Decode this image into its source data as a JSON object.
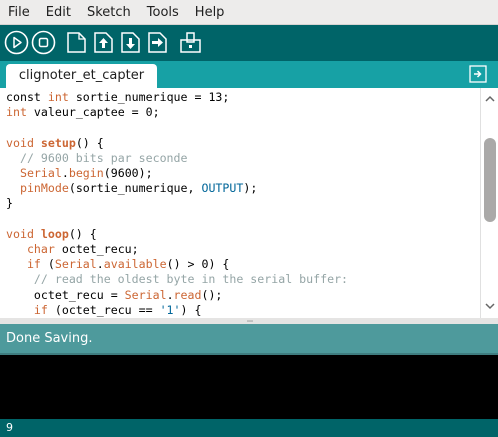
{
  "menu": {
    "items": [
      "File",
      "Edit",
      "Sketch",
      "Tools",
      "Help"
    ]
  },
  "toolbar": {
    "buttons": [
      {
        "name": "verify",
        "icon": "play-icon"
      },
      {
        "name": "stop",
        "icon": "stop-icon"
      },
      {
        "name": "new",
        "icon": "new-file-icon"
      },
      {
        "name": "open",
        "icon": "open-arrow-up-icon"
      },
      {
        "name": "save",
        "icon": "save-arrow-down-icon"
      },
      {
        "name": "upload",
        "icon": "upload-arrow-right-icon"
      },
      {
        "name": "serial-monitor",
        "icon": "serial-monitor-icon"
      }
    ]
  },
  "tabs": {
    "active": "clignoter_et_capter",
    "menu_icon": "tab-menu-arrow-icon"
  },
  "editor": {
    "lines": [
      [
        {
          "t": "const "
        },
        {
          "t": "int",
          "c": "kw"
        },
        {
          "t": " sortie_numerique = 13;"
        }
      ],
      [
        {
          "t": "int",
          "c": "kw"
        },
        {
          "t": " valeur_captee = 0;"
        }
      ],
      [],
      [
        {
          "t": "void",
          "c": "kw"
        },
        {
          "t": " "
        },
        {
          "t": "setup",
          "c": "fn"
        },
        {
          "t": "() {"
        }
      ],
      [
        {
          "t": "  "
        },
        {
          "t": "// 9600 bits par seconde",
          "c": "cm"
        }
      ],
      [
        {
          "t": "  "
        },
        {
          "t": "Serial",
          "c": "kw"
        },
        {
          "t": "."
        },
        {
          "t": "begin",
          "c": "kw"
        },
        {
          "t": "(9600);"
        }
      ],
      [
        {
          "t": "  "
        },
        {
          "t": "pinMode",
          "c": "kw"
        },
        {
          "t": "(sortie_numerique, "
        },
        {
          "t": "OUTPUT",
          "c": "kw2"
        },
        {
          "t": ");"
        }
      ],
      [
        {
          "t": "}"
        }
      ],
      [],
      [
        {
          "t": "void",
          "c": "kw"
        },
        {
          "t": " "
        },
        {
          "t": "loop",
          "c": "fn"
        },
        {
          "t": "() {"
        }
      ],
      [
        {
          "t": "   "
        },
        {
          "t": "char",
          "c": "kw"
        },
        {
          "t": " octet_recu;"
        }
      ],
      [
        {
          "t": "   "
        },
        {
          "t": "if",
          "c": "kw"
        },
        {
          "t": " ("
        },
        {
          "t": "Serial",
          "c": "kw"
        },
        {
          "t": "."
        },
        {
          "t": "available",
          "c": "kw"
        },
        {
          "t": "() > 0) {"
        }
      ],
      [
        {
          "t": "    "
        },
        {
          "t": "// read the oldest byte in the serial buffer:",
          "c": "cm"
        }
      ],
      [
        {
          "t": "    octet_recu = "
        },
        {
          "t": "Serial",
          "c": "kw"
        },
        {
          "t": "."
        },
        {
          "t": "read",
          "c": "kw"
        },
        {
          "t": "();"
        }
      ],
      [
        {
          "t": "    "
        },
        {
          "t": "if",
          "c": "kw"
        },
        {
          "t": " (octet_recu == "
        },
        {
          "t": "'1'",
          "c": "str"
        },
        {
          "t": ") {"
        }
      ]
    ]
  },
  "status": {
    "message": "Done Saving."
  },
  "footer": {
    "line_number": "9"
  },
  "colors": {
    "toolbar_bg": "#006468",
    "tabbar_bg": "#17a1a5",
    "status_bg": "#4e9a9c",
    "console_bg": "#000000",
    "keyword": "#cc6633",
    "constant": "#006699",
    "comment": "#95a5a6"
  }
}
